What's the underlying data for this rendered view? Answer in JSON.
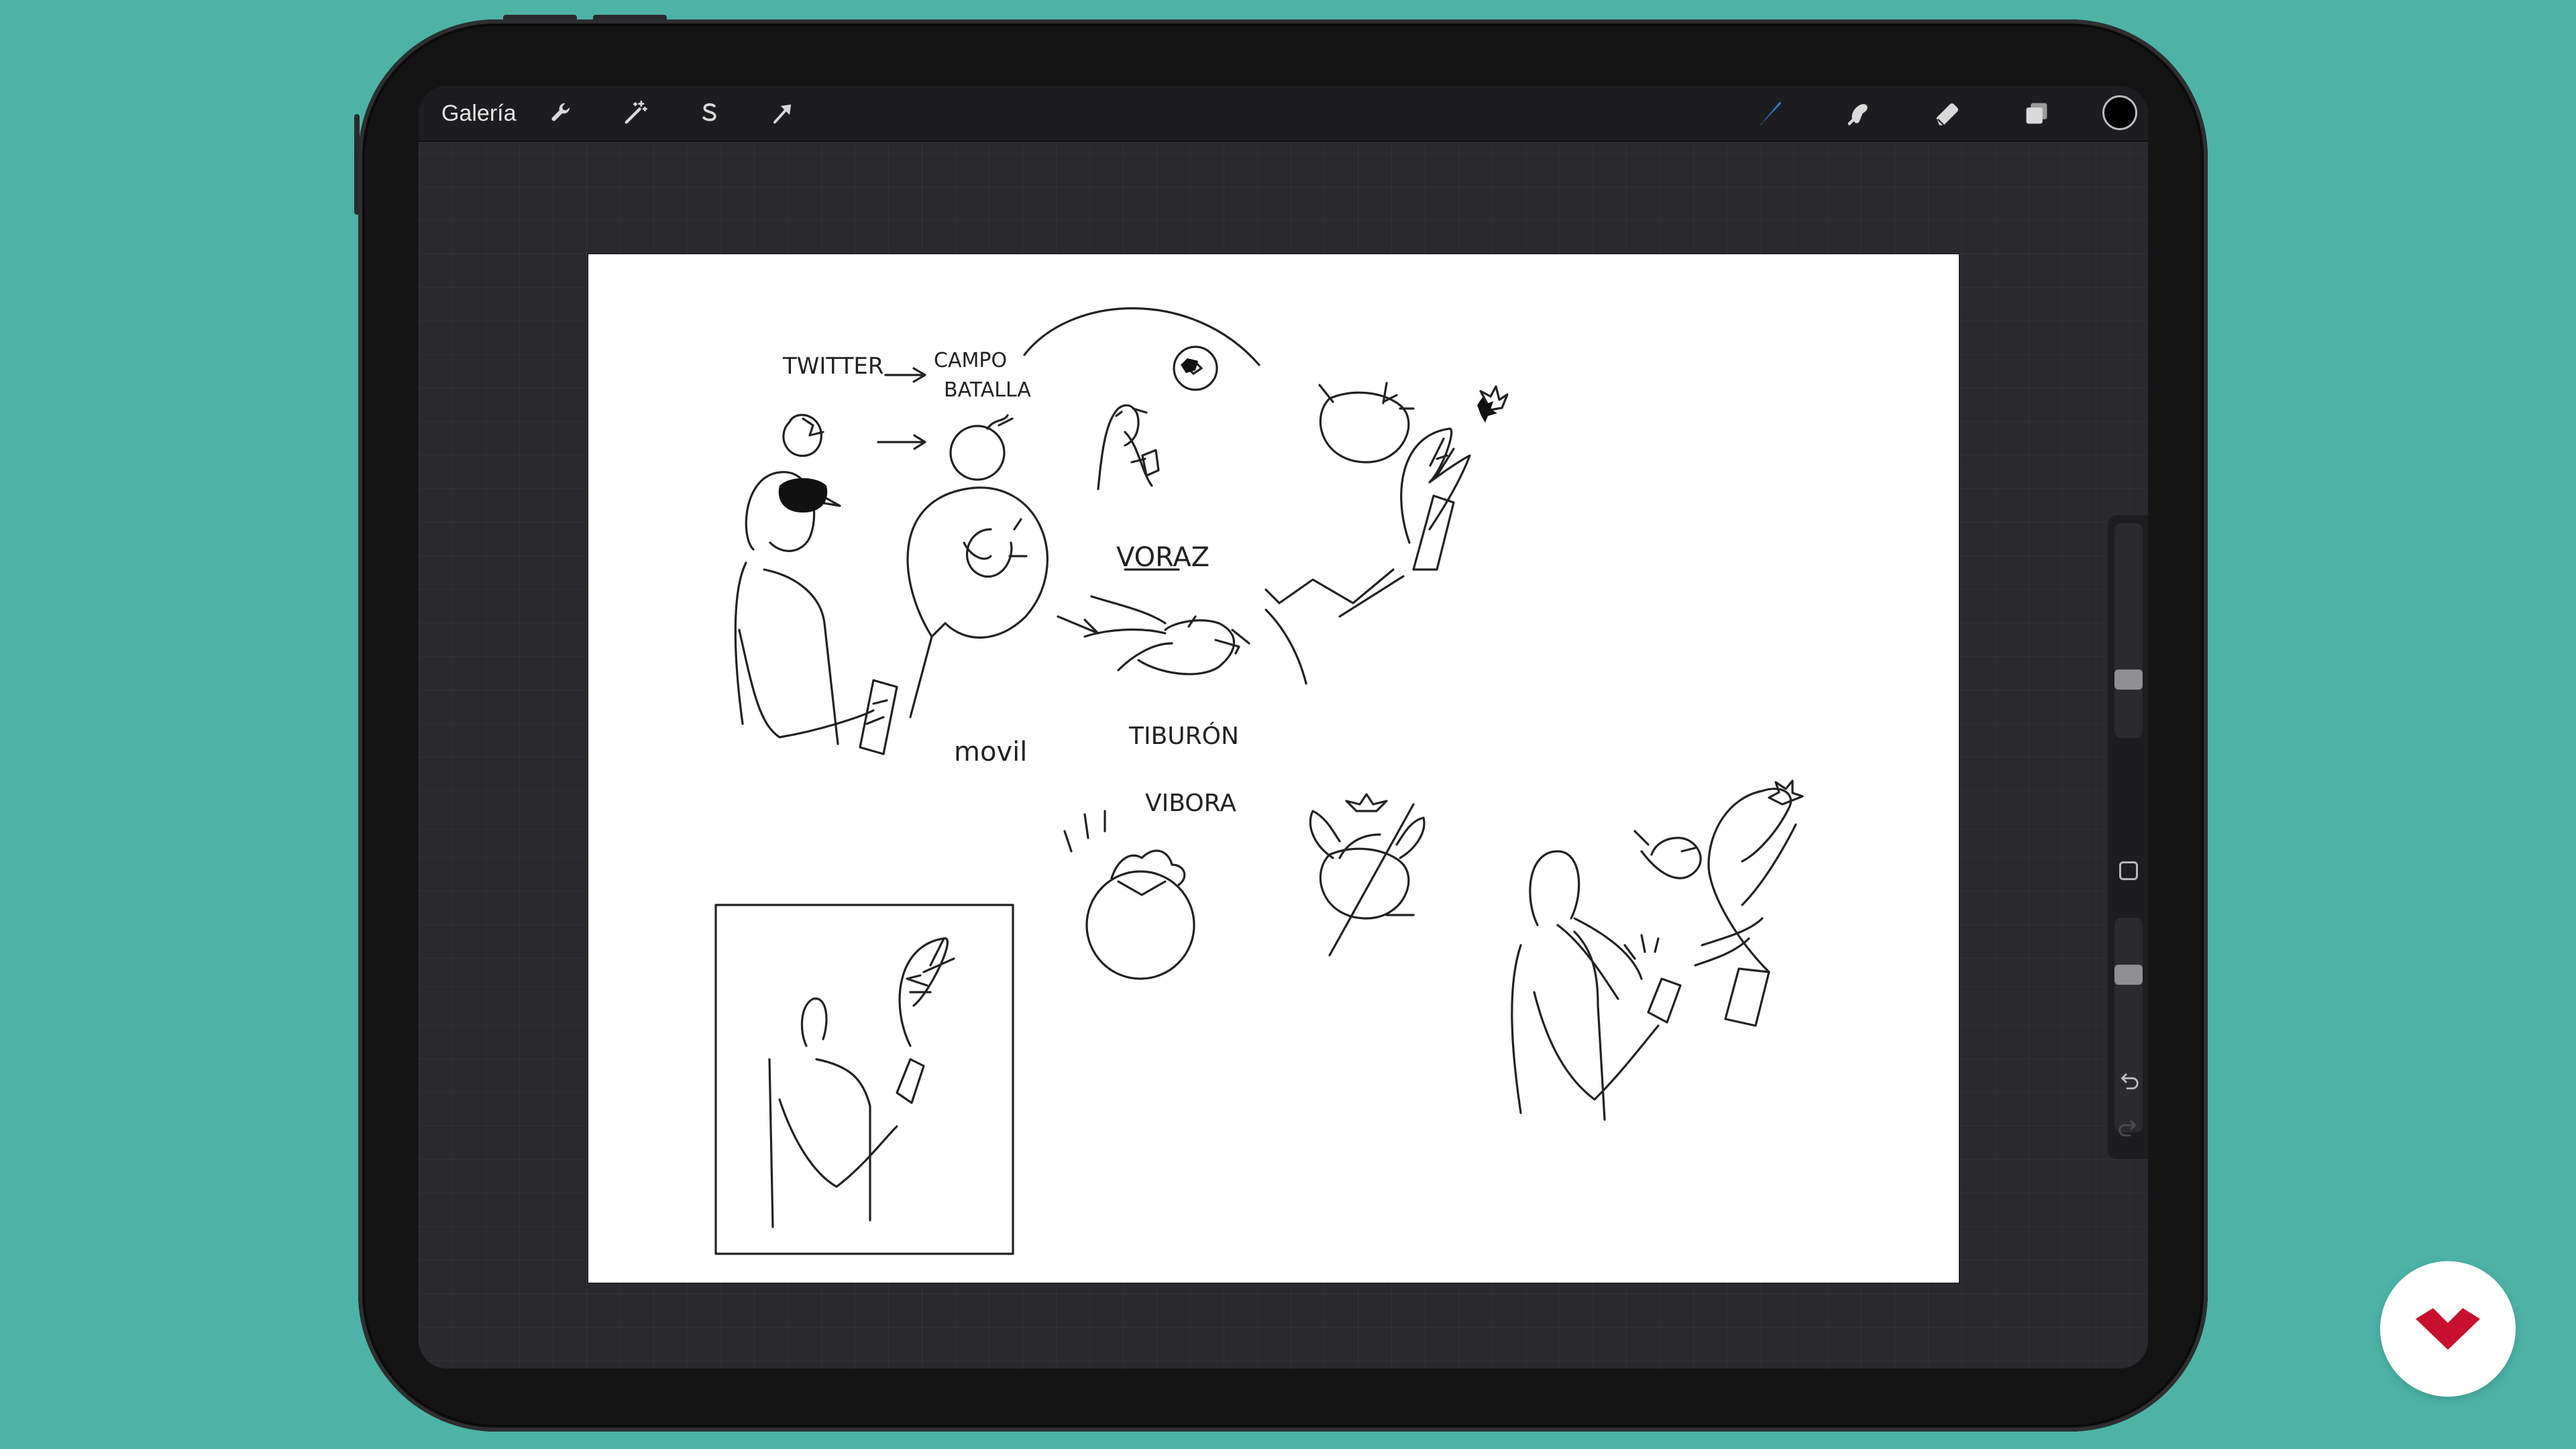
{
  "app": {
    "gallery_label": "Galería"
  },
  "toolbar": {
    "left_icons": [
      "wrench-icon",
      "magic-wand-icon",
      "selection-s-icon",
      "arrow-transform-icon"
    ],
    "right_icons": [
      "brush-icon",
      "smudge-icon",
      "eraser-icon",
      "layers-icon"
    ],
    "active_tool": "brush",
    "active_color": "#000000"
  },
  "sidebar": {
    "brush_size_level": 0.35,
    "opacity_level": 0.42,
    "icons": [
      "modify-square-icon",
      "undo-icon",
      "redo-icon"
    ]
  },
  "sketch": {
    "labels": {
      "twitter": "TWITTER",
      "campo": "CAMPO",
      "batalla": "BATALLA",
      "voraz": "VORAZ",
      "movil": "movil",
      "tiburon": "TIBURÓN",
      "vibora": "VIBORA"
    }
  },
  "colors": {
    "background": "#4db3a7",
    "accent_brush": "#2f7fe0",
    "logo_red": "#c8102e"
  }
}
